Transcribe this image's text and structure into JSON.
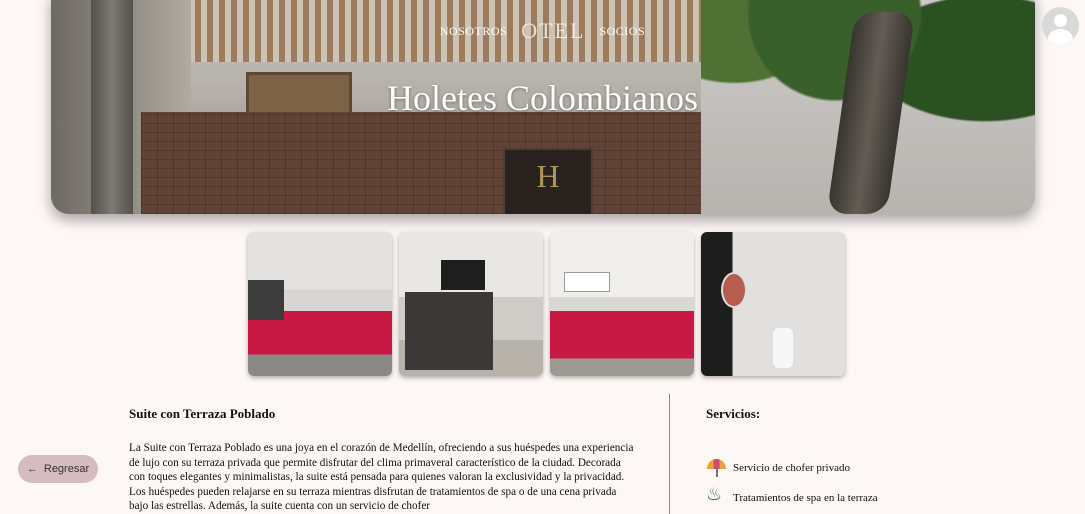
{
  "header": {
    "nav_left": "NOSOTROS",
    "logo": "OTEL",
    "nav_right": "SOCIOS",
    "hero_title": "Holetes Colombianos",
    "sign_letter": "H"
  },
  "gallery": {
    "images": [
      "bedroom-wide",
      "bedroom-tv-wardrobe",
      "bedroom-corner",
      "bathroom"
    ]
  },
  "suite": {
    "title": "Suite con Terraza Poblado",
    "description": "La Suite con Terraza Poblado es una joya en el corazón de Medellín, ofreciendo a sus huéspedes una experiencia de lujo con su terraza privada que permite disfrutar del clima primaveral característico de la ciudad. Decorada con toques elegantes y minimalistas, la suite está pensada para quienes valoran la exclusividad y la privacidad. Los huéspedes pueden relajarse en su terraza mientras disfrutan de tratamientos de spa o de una cena privada bajo las estrellas. Además, la suite cuenta con un servicio de chofer"
  },
  "services": {
    "title": "Servicios:",
    "items": [
      {
        "label": "Servicio de chofer privado",
        "icon": "umbrella-icon"
      },
      {
        "label": "Tratamientos de spa en la terraza",
        "icon": "spa-icon"
      }
    ]
  },
  "back_button": {
    "label": "Regresar",
    "icon": "arrow-left-icon"
  },
  "colors": {
    "background": "#fdf8f6",
    "back_button": "#d4bcbf",
    "accent": "#c81944"
  }
}
